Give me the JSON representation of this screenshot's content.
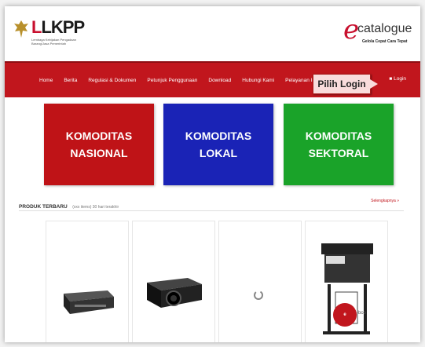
{
  "header": {
    "logo_text": "LKPP",
    "logo_subtitle": "Lembaga Kebijakan Pengadaan Barang/Jasa Pemerintah",
    "brand": "catalogue",
    "brand_tagline": "Gelola Cepat Cara Tepat"
  },
  "nav": {
    "items": [
      "Home",
      "Berita",
      "Regulasi & Dokumen",
      "Petunjuk Penggunaan",
      "Download",
      "Hubungi Kami",
      "Pelayanan Informasi"
    ],
    "login_label": "Login"
  },
  "callout": "Pilih Login",
  "tiles": [
    {
      "label": "KOMODITAS\nNASIONAL",
      "color": "#bf1317"
    },
    {
      "label": "KOMODITAS\nLOKAL",
      "color": "#1a23b6"
    },
    {
      "label": "KOMODITAS\nSEKTORAL",
      "color": "#1aa329"
    }
  ],
  "products": {
    "title": "PRODUK TERBARU",
    "meta": "(xxx items) 30 hari terakhir",
    "more": "Selengkapnya »"
  },
  "badge": {
    "label": "e",
    "text": "-bco"
  }
}
